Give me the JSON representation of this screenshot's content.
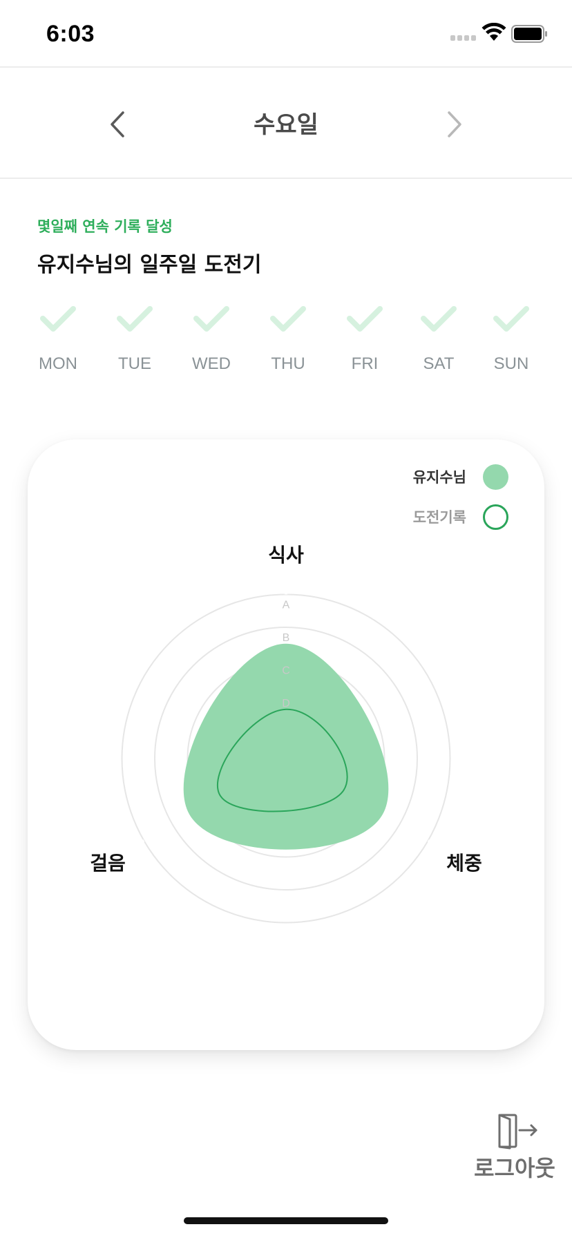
{
  "status_bar": {
    "time": "6:03",
    "icons": [
      "signal-icon",
      "wifi-icon",
      "battery-icon"
    ]
  },
  "nav": {
    "title": "수요일",
    "prev_icon": "chevron-left-icon",
    "next_icon": "chevron-right-icon"
  },
  "streak": {
    "label": "몇일째 연속 기록 달성",
    "title": "유지수님의 일주일 도전기"
  },
  "week": [
    {
      "day": "MON",
      "checked": true
    },
    {
      "day": "TUE",
      "checked": true
    },
    {
      "day": "WED",
      "checked": true
    },
    {
      "day": "THU",
      "checked": true
    },
    {
      "day": "FRI",
      "checked": true
    },
    {
      "day": "SAT",
      "checked": true
    },
    {
      "day": "SUN",
      "checked": true
    }
  ],
  "chart_data": {
    "type": "radar",
    "axes": [
      "식사",
      "체중",
      "걸음"
    ],
    "scale_levels": [
      "A",
      "B",
      "C",
      "D"
    ],
    "legend_placement": "top-right",
    "series": [
      {
        "name": "유지수님",
        "style": "filled",
        "color": "#94d8ad",
        "values": [
          3.5,
          3.4,
          3.4
        ]
      },
      {
        "name": "도전기록",
        "style": "outline",
        "color": "#2aa55a",
        "values": [
          1.5,
          2.0,
          2.3
        ]
      }
    ],
    "max": 5
  },
  "colors": {
    "accent": "#2eae5b",
    "check": "#d6f1df",
    "fill": "#94d8ad",
    "outline": "#2aa55a"
  },
  "logout": {
    "label": "로그아웃",
    "icon": "logout-door-icon"
  }
}
